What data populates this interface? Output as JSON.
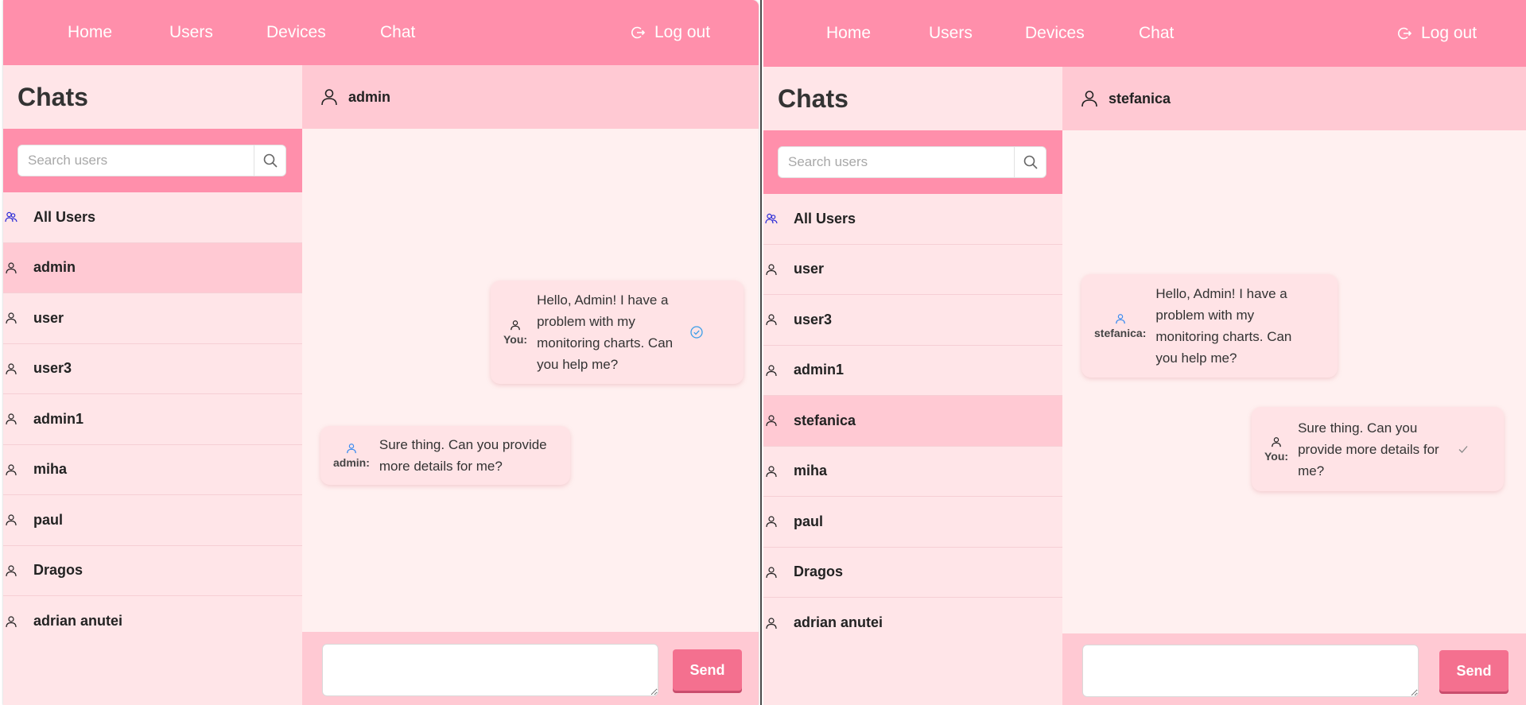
{
  "colors": {
    "navbar": "#ff8fab",
    "sidebar": "#ffe5e8",
    "active_item": "#ffc9d3",
    "chat_bg": "#fff0f0",
    "bubble": "#ffe3e6",
    "send_button": "#f4708f",
    "all_users_icon": "#2b2bd6",
    "sender_icon_other": "#3b8cf0",
    "read_check": "#3b9ee8"
  },
  "nav": {
    "home": "Home",
    "users": "Users",
    "devices": "Devices",
    "chat": "Chat",
    "logout": "Log out"
  },
  "sidebar": {
    "title": "Chats",
    "search_placeholder": "Search users"
  },
  "left": {
    "users": [
      {
        "name": "All Users",
        "icon": "users-group-icon"
      },
      {
        "name": "admin",
        "icon": "user-icon"
      },
      {
        "name": "user",
        "icon": "user-icon"
      },
      {
        "name": "user3",
        "icon": "user-icon"
      },
      {
        "name": "admin1",
        "icon": "user-icon"
      },
      {
        "name": "miha",
        "icon": "user-icon"
      },
      {
        "name": "paul",
        "icon": "user-icon"
      },
      {
        "name": "Dragos",
        "icon": "user-icon"
      },
      {
        "name": "adrian anutei",
        "icon": "user-icon"
      }
    ],
    "active_user": "admin",
    "chat_with": "admin",
    "messages": [
      {
        "sender": "You:",
        "text_lines": [
          "Hello, Admin! I have a",
          "problem with my",
          "monitoring charts. Can",
          "you help me?"
        ],
        "status": "read-check-icon"
      },
      {
        "sender": "admin:",
        "text_lines": [
          "Sure thing. Can you provide",
          "more details for me?"
        ]
      }
    ],
    "send_label": "Send"
  },
  "right": {
    "users": [
      {
        "name": "All Users",
        "icon": "users-group-icon"
      },
      {
        "name": "user",
        "icon": "user-icon"
      },
      {
        "name": "user3",
        "icon": "user-icon"
      },
      {
        "name": "admin1",
        "icon": "user-icon"
      },
      {
        "name": "stefanica",
        "icon": "user-icon"
      },
      {
        "name": "miha",
        "icon": "user-icon"
      },
      {
        "name": "paul",
        "icon": "user-icon"
      },
      {
        "name": "Dragos",
        "icon": "user-icon"
      },
      {
        "name": "adrian anutei",
        "icon": "user-icon"
      }
    ],
    "active_user": "stefanica",
    "chat_with": "stefanica",
    "messages": [
      {
        "sender": "stefanica:",
        "text_lines": [
          "Hello, Admin! I have a",
          "problem with my",
          "monitoring charts. Can",
          "you help me?"
        ]
      },
      {
        "sender": "You:",
        "text_lines": [
          "Sure thing. Can you",
          "provide more details for",
          "me?"
        ],
        "status": "sent-check-icon"
      }
    ],
    "send_label": "Send"
  }
}
